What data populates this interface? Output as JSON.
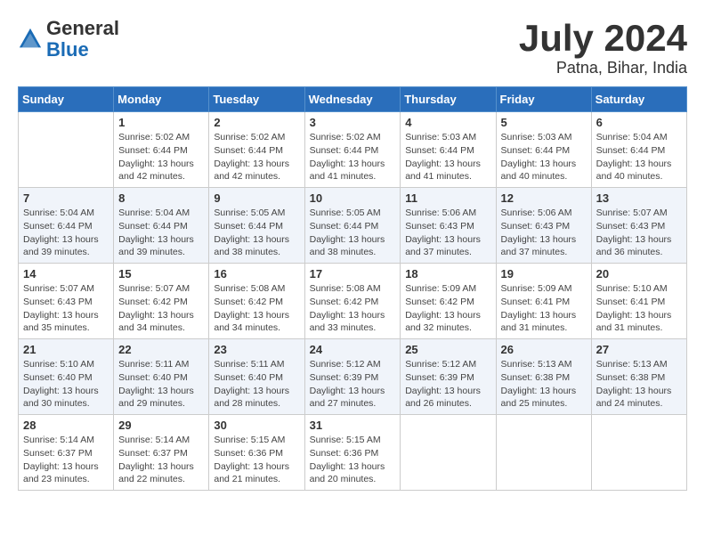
{
  "header": {
    "logo_general": "General",
    "logo_blue": "Blue",
    "month_year": "July 2024",
    "location": "Patna, Bihar, India"
  },
  "weekdays": [
    "Sunday",
    "Monday",
    "Tuesday",
    "Wednesday",
    "Thursday",
    "Friday",
    "Saturday"
  ],
  "weeks": [
    [
      {
        "day": "",
        "info": ""
      },
      {
        "day": "1",
        "info": "Sunrise: 5:02 AM\nSunset: 6:44 PM\nDaylight: 13 hours\nand 42 minutes."
      },
      {
        "day": "2",
        "info": "Sunrise: 5:02 AM\nSunset: 6:44 PM\nDaylight: 13 hours\nand 42 minutes."
      },
      {
        "day": "3",
        "info": "Sunrise: 5:02 AM\nSunset: 6:44 PM\nDaylight: 13 hours\nand 41 minutes."
      },
      {
        "day": "4",
        "info": "Sunrise: 5:03 AM\nSunset: 6:44 PM\nDaylight: 13 hours\nand 41 minutes."
      },
      {
        "day": "5",
        "info": "Sunrise: 5:03 AM\nSunset: 6:44 PM\nDaylight: 13 hours\nand 40 minutes."
      },
      {
        "day": "6",
        "info": "Sunrise: 5:04 AM\nSunset: 6:44 PM\nDaylight: 13 hours\nand 40 minutes."
      }
    ],
    [
      {
        "day": "7",
        "info": "Sunrise: 5:04 AM\nSunset: 6:44 PM\nDaylight: 13 hours\nand 39 minutes."
      },
      {
        "day": "8",
        "info": "Sunrise: 5:04 AM\nSunset: 6:44 PM\nDaylight: 13 hours\nand 39 minutes."
      },
      {
        "day": "9",
        "info": "Sunrise: 5:05 AM\nSunset: 6:44 PM\nDaylight: 13 hours\nand 38 minutes."
      },
      {
        "day": "10",
        "info": "Sunrise: 5:05 AM\nSunset: 6:44 PM\nDaylight: 13 hours\nand 38 minutes."
      },
      {
        "day": "11",
        "info": "Sunrise: 5:06 AM\nSunset: 6:43 PM\nDaylight: 13 hours\nand 37 minutes."
      },
      {
        "day": "12",
        "info": "Sunrise: 5:06 AM\nSunset: 6:43 PM\nDaylight: 13 hours\nand 37 minutes."
      },
      {
        "day": "13",
        "info": "Sunrise: 5:07 AM\nSunset: 6:43 PM\nDaylight: 13 hours\nand 36 minutes."
      }
    ],
    [
      {
        "day": "14",
        "info": "Sunrise: 5:07 AM\nSunset: 6:43 PM\nDaylight: 13 hours\nand 35 minutes."
      },
      {
        "day": "15",
        "info": "Sunrise: 5:07 AM\nSunset: 6:42 PM\nDaylight: 13 hours\nand 34 minutes."
      },
      {
        "day": "16",
        "info": "Sunrise: 5:08 AM\nSunset: 6:42 PM\nDaylight: 13 hours\nand 34 minutes."
      },
      {
        "day": "17",
        "info": "Sunrise: 5:08 AM\nSunset: 6:42 PM\nDaylight: 13 hours\nand 33 minutes."
      },
      {
        "day": "18",
        "info": "Sunrise: 5:09 AM\nSunset: 6:42 PM\nDaylight: 13 hours\nand 32 minutes."
      },
      {
        "day": "19",
        "info": "Sunrise: 5:09 AM\nSunset: 6:41 PM\nDaylight: 13 hours\nand 31 minutes."
      },
      {
        "day": "20",
        "info": "Sunrise: 5:10 AM\nSunset: 6:41 PM\nDaylight: 13 hours\nand 31 minutes."
      }
    ],
    [
      {
        "day": "21",
        "info": "Sunrise: 5:10 AM\nSunset: 6:40 PM\nDaylight: 13 hours\nand 30 minutes."
      },
      {
        "day": "22",
        "info": "Sunrise: 5:11 AM\nSunset: 6:40 PM\nDaylight: 13 hours\nand 29 minutes."
      },
      {
        "day": "23",
        "info": "Sunrise: 5:11 AM\nSunset: 6:40 PM\nDaylight: 13 hours\nand 28 minutes."
      },
      {
        "day": "24",
        "info": "Sunrise: 5:12 AM\nSunset: 6:39 PM\nDaylight: 13 hours\nand 27 minutes."
      },
      {
        "day": "25",
        "info": "Sunrise: 5:12 AM\nSunset: 6:39 PM\nDaylight: 13 hours\nand 26 minutes."
      },
      {
        "day": "26",
        "info": "Sunrise: 5:13 AM\nSunset: 6:38 PM\nDaylight: 13 hours\nand 25 minutes."
      },
      {
        "day": "27",
        "info": "Sunrise: 5:13 AM\nSunset: 6:38 PM\nDaylight: 13 hours\nand 24 minutes."
      }
    ],
    [
      {
        "day": "28",
        "info": "Sunrise: 5:14 AM\nSunset: 6:37 PM\nDaylight: 13 hours\nand 23 minutes."
      },
      {
        "day": "29",
        "info": "Sunrise: 5:14 AM\nSunset: 6:37 PM\nDaylight: 13 hours\nand 22 minutes."
      },
      {
        "day": "30",
        "info": "Sunrise: 5:15 AM\nSunset: 6:36 PM\nDaylight: 13 hours\nand 21 minutes."
      },
      {
        "day": "31",
        "info": "Sunrise: 5:15 AM\nSunset: 6:36 PM\nDaylight: 13 hours\nand 20 minutes."
      },
      {
        "day": "",
        "info": ""
      },
      {
        "day": "",
        "info": ""
      },
      {
        "day": "",
        "info": ""
      }
    ]
  ]
}
